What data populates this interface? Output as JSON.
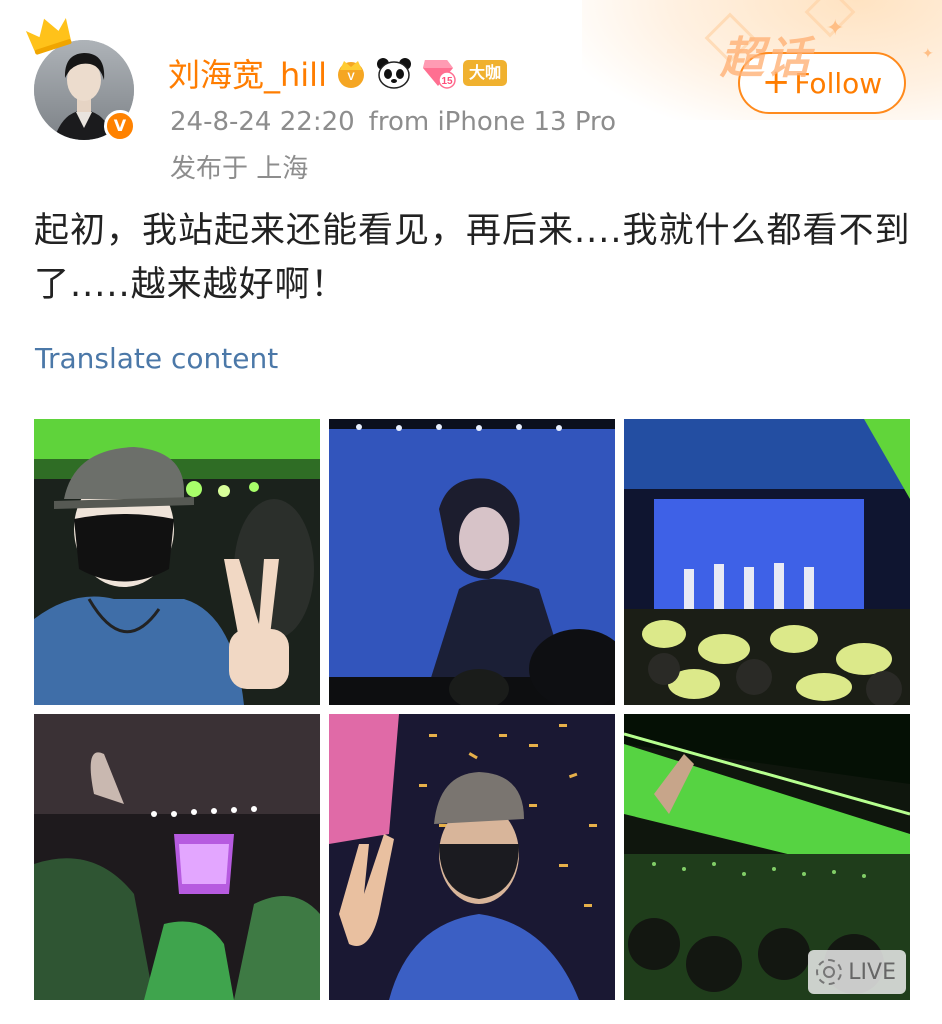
{
  "post": {
    "username": "刘海宽_hill",
    "tag_label": "大咖",
    "time": "24-8-24 22:20",
    "source": "from iPhone 13 Pro",
    "location": "发布于 上海",
    "follow_label": "Follow",
    "text": "起初，我站起来还能看见，再后来....我就什么都看不到了.....越来越好啊！",
    "translate_label": "Translate content",
    "corner_label": "超话",
    "live_label": "LIVE"
  },
  "icons": {
    "verified": "v-badge",
    "crown": "crown-icon",
    "level": "level-15-icon",
    "panda": "panda-icon",
    "vip": "vip-crown-icon"
  },
  "colors": {
    "accent": "#ff7d00",
    "link": "#4b78a8",
    "meta": "#8d8d8d"
  },
  "level_number": "15",
  "photos": [
    "photo-1",
    "photo-2",
    "photo-3",
    "photo-4",
    "photo-5",
    "photo-6"
  ]
}
